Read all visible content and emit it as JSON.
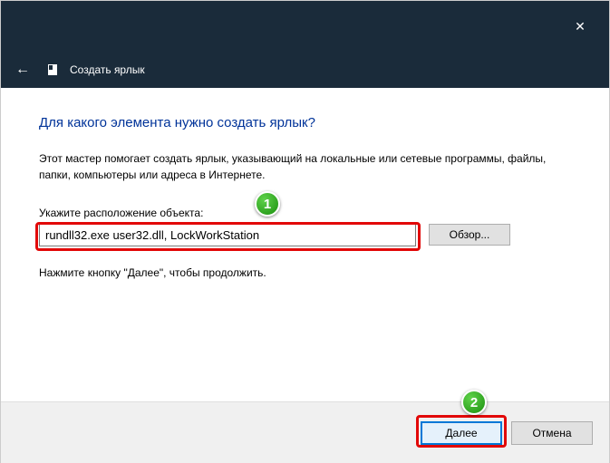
{
  "titlebar": {
    "close_glyph": "✕"
  },
  "header": {
    "back_glyph": "←",
    "title": "Создать ярлык"
  },
  "content": {
    "heading": "Для какого элемента нужно создать ярлык?",
    "description": "Этот мастер помогает создать ярлык, указывающий на локальные или сетевые программы, файлы, папки, компьютеры или адреса в Интернете.",
    "field_label": "Укажите расположение объекта:",
    "path_value": "rundll32.exe user32.dll, LockWorkStation",
    "browse_label": "Обзор...",
    "hint": "Нажмите кнопку \"Далее\", чтобы продолжить."
  },
  "footer": {
    "next_label": "Далее",
    "cancel_label": "Отмена"
  },
  "annotations": {
    "badge1": "1",
    "badge2": "2"
  }
}
